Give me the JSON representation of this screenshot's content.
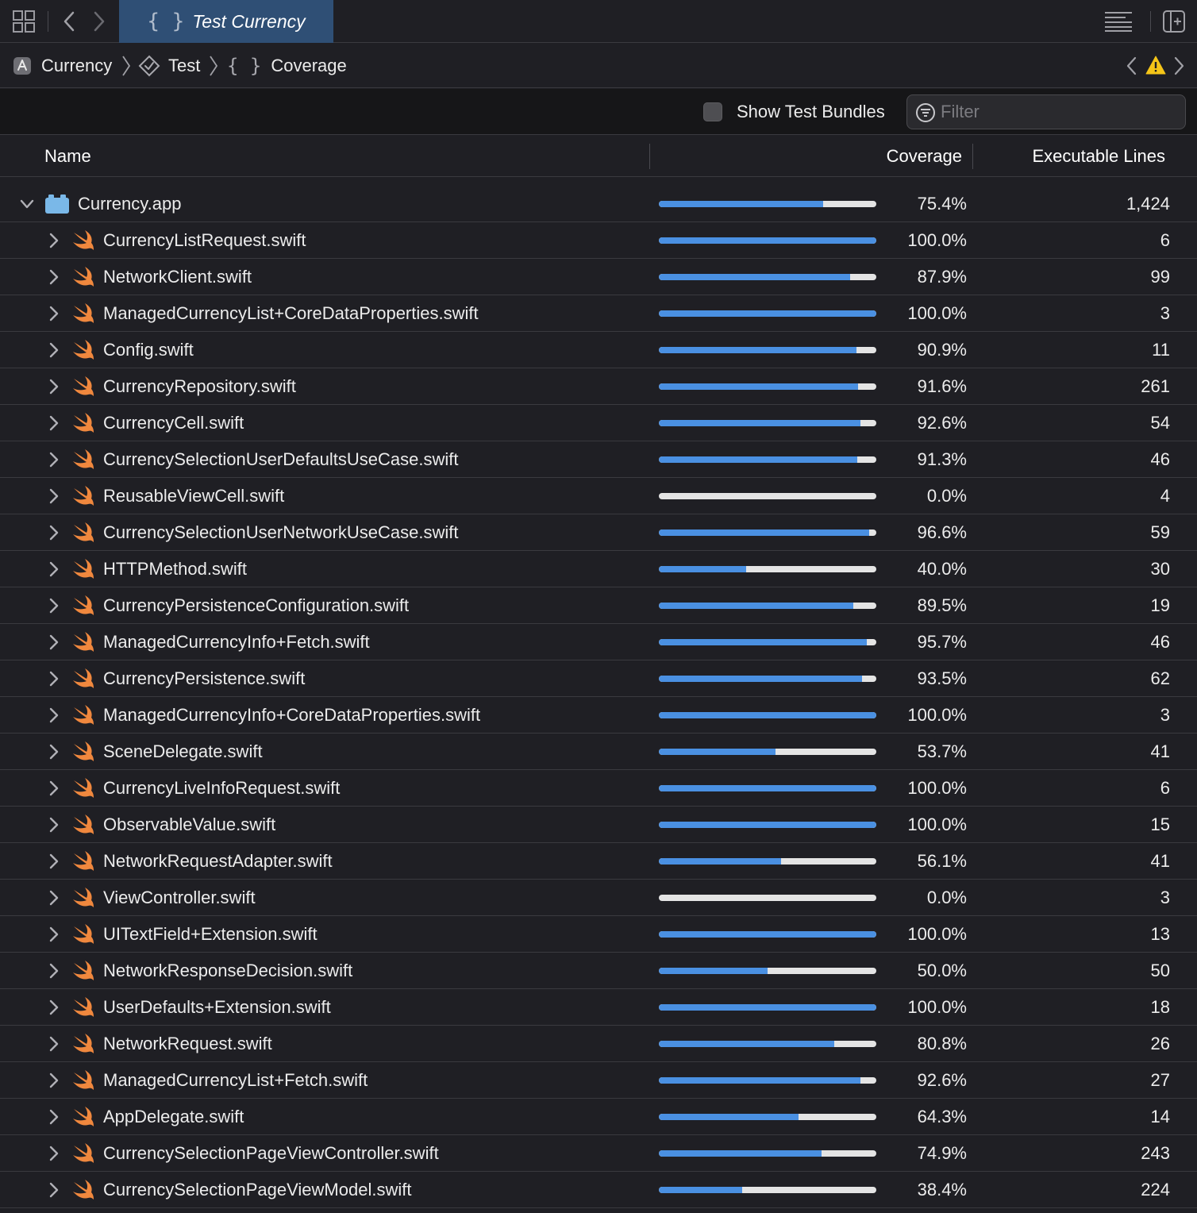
{
  "tab": {
    "title": "Test Currency",
    "braces": "{ }"
  },
  "breadcrumb": {
    "project": "Currency",
    "scheme": "Test",
    "section": "Coverage",
    "section_braces": "{ }"
  },
  "filterbar": {
    "show_test_bundles_label": "Show Test Bundles",
    "show_test_bundles_checked": false,
    "filter_placeholder": "Filter"
  },
  "columns": {
    "name": "Name",
    "coverage": "Coverage",
    "lines": "Executable Lines"
  },
  "colors": {
    "accent": "#4a90e2",
    "tab_active": "#2f4f75",
    "swift_orange": "#f0883e",
    "warning": "#f5c518"
  },
  "target": {
    "name": "Currency.app",
    "percent": "75.4%",
    "coverage": 0.754,
    "lines": "1,424"
  },
  "files": [
    {
      "name": "CurrencyListRequest.swift",
      "percent": "100.0%",
      "coverage": 1.0,
      "lines": "6"
    },
    {
      "name": "NetworkClient.swift",
      "percent": "87.9%",
      "coverage": 0.879,
      "lines": "99"
    },
    {
      "name": "ManagedCurrencyList+CoreDataProperties.swift",
      "percent": "100.0%",
      "coverage": 1.0,
      "lines": "3"
    },
    {
      "name": "Config.swift",
      "percent": "90.9%",
      "coverage": 0.909,
      "lines": "11"
    },
    {
      "name": "CurrencyRepository.swift",
      "percent": "91.6%",
      "coverage": 0.916,
      "lines": "261"
    },
    {
      "name": "CurrencyCell.swift",
      "percent": "92.6%",
      "coverage": 0.926,
      "lines": "54"
    },
    {
      "name": "CurrencySelectionUserDefaultsUseCase.swift",
      "percent": "91.3%",
      "coverage": 0.913,
      "lines": "46"
    },
    {
      "name": "ReusableViewCell.swift",
      "percent": "0.0%",
      "coverage": 0.0,
      "lines": "4"
    },
    {
      "name": "CurrencySelectionUserNetworkUseCase.swift",
      "percent": "96.6%",
      "coverage": 0.966,
      "lines": "59"
    },
    {
      "name": "HTTPMethod.swift",
      "percent": "40.0%",
      "coverage": 0.4,
      "lines": "30"
    },
    {
      "name": "CurrencyPersistenceConfiguration.swift",
      "percent": "89.5%",
      "coverage": 0.895,
      "lines": "19"
    },
    {
      "name": "ManagedCurrencyInfo+Fetch.swift",
      "percent": "95.7%",
      "coverage": 0.957,
      "lines": "46"
    },
    {
      "name": "CurrencyPersistence.swift",
      "percent": "93.5%",
      "coverage": 0.935,
      "lines": "62"
    },
    {
      "name": "ManagedCurrencyInfo+CoreDataProperties.swift",
      "percent": "100.0%",
      "coverage": 1.0,
      "lines": "3"
    },
    {
      "name": "SceneDelegate.swift",
      "percent": "53.7%",
      "coverage": 0.537,
      "lines": "41"
    },
    {
      "name": "CurrencyLiveInfoRequest.swift",
      "percent": "100.0%",
      "coverage": 1.0,
      "lines": "6"
    },
    {
      "name": "ObservableValue.swift",
      "percent": "100.0%",
      "coverage": 1.0,
      "lines": "15"
    },
    {
      "name": "NetworkRequestAdapter.swift",
      "percent": "56.1%",
      "coverage": 0.561,
      "lines": "41"
    },
    {
      "name": "ViewController.swift",
      "percent": "0.0%",
      "coverage": 0.0,
      "lines": "3"
    },
    {
      "name": "UITextField+Extension.swift",
      "percent": "100.0%",
      "coverage": 1.0,
      "lines": "13"
    },
    {
      "name": "NetworkResponseDecision.swift",
      "percent": "50.0%",
      "coverage": 0.5,
      "lines": "50"
    },
    {
      "name": "UserDefaults+Extension.swift",
      "percent": "100.0%",
      "coverage": 1.0,
      "lines": "18"
    },
    {
      "name": "NetworkRequest.swift",
      "percent": "80.8%",
      "coverage": 0.808,
      "lines": "26"
    },
    {
      "name": "ManagedCurrencyList+Fetch.swift",
      "percent": "92.6%",
      "coverage": 0.926,
      "lines": "27"
    },
    {
      "name": "AppDelegate.swift",
      "percent": "64.3%",
      "coverage": 0.643,
      "lines": "14"
    },
    {
      "name": "CurrencySelectionPageViewController.swift",
      "percent": "74.9%",
      "coverage": 0.749,
      "lines": "243"
    },
    {
      "name": "CurrencySelectionPageViewModel.swift",
      "percent": "38.4%",
      "coverage": 0.384,
      "lines": "224"
    }
  ]
}
